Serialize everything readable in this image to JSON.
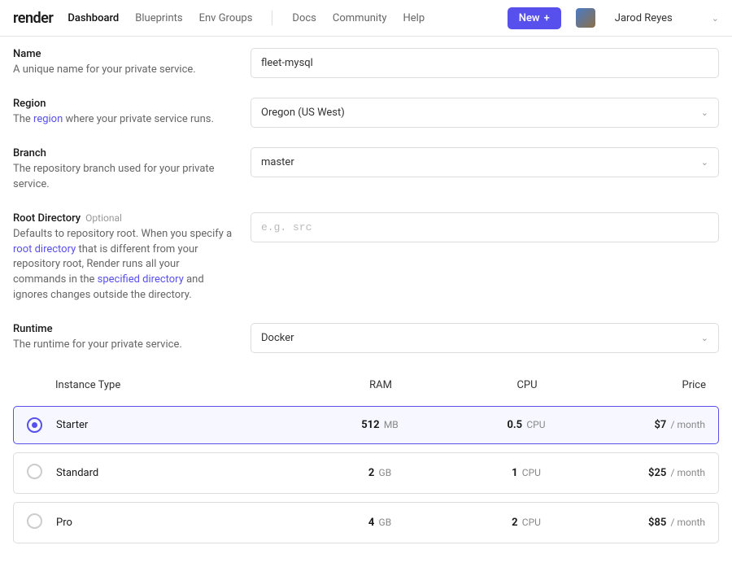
{
  "nav": {
    "logo": "render",
    "dashboard": "Dashboard",
    "blueprints": "Blueprints",
    "envgroups": "Env Groups",
    "docs": "Docs",
    "community": "Community",
    "help": "Help",
    "new": "New",
    "user": "Jarod Reyes"
  },
  "name": {
    "label": "Name",
    "sub": "A unique name for your private service.",
    "value": "fleet-mysql"
  },
  "region": {
    "label": "Region",
    "sub_pre": "The ",
    "link": "region",
    "sub_post": " where your private service runs.",
    "value": "Oregon (US West)"
  },
  "branch": {
    "label": "Branch",
    "sub": "The repository branch used for your private service.",
    "value": "master"
  },
  "rootdir": {
    "label": "Root Directory",
    "optional": "Optional",
    "sub_a": "Defaults to repository root. When you specify a ",
    "link1": "root directory",
    "sub_b": " that is different from your repository root, Render runs all your commands in the ",
    "link2": "specified directory",
    "sub_c": " and ignores changes outside the directory.",
    "placeholder": "e.g. src"
  },
  "runtime": {
    "label": "Runtime",
    "sub": "The runtime for your private service.",
    "value": "Docker"
  },
  "table": {
    "h1": "Instance Type",
    "h2": "RAM",
    "h3": "CPU",
    "h4": "Price",
    "rows": [
      {
        "name": "Starter",
        "ram_v": "512",
        "ram_u": "MB",
        "cpu_v": "0.5",
        "cpu_u": "CPU",
        "price": "$7",
        "per": "/ month",
        "sel": true
      },
      {
        "name": "Standard",
        "ram_v": "2",
        "ram_u": "GB",
        "cpu_v": "1",
        "cpu_u": "CPU",
        "price": "$25",
        "per": "/ month",
        "sel": false
      },
      {
        "name": "Pro",
        "ram_v": "4",
        "ram_u": "GB",
        "cpu_v": "2",
        "cpu_u": "CPU",
        "price": "$85",
        "per": "/ month",
        "sel": false
      }
    ]
  }
}
